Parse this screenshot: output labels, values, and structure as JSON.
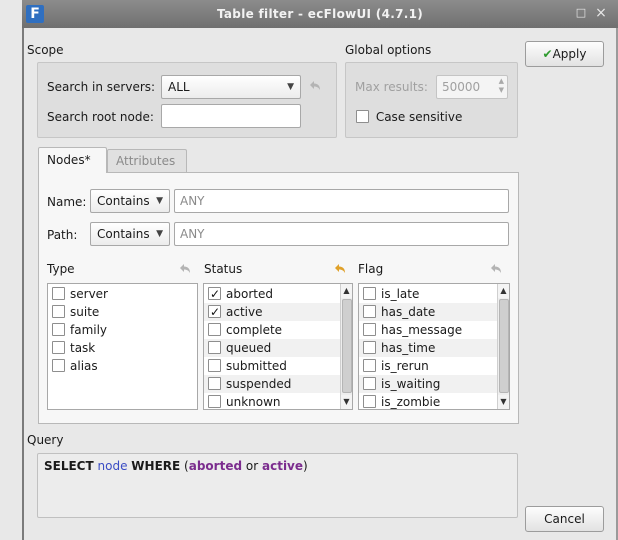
{
  "window": {
    "title": "Table filter  -  ecFlowUI (4.7.1)",
    "app_icon_letter": "F",
    "maximize_glyph": "□",
    "close_glyph": "×"
  },
  "scope": {
    "heading": "Scope",
    "search_servers_label": "Search in servers:",
    "search_servers_value": "ALL",
    "search_root_label": "Search root node:",
    "search_root_value": ""
  },
  "global_options": {
    "heading": "Global options",
    "max_results_label": "Max results:",
    "max_results_value": "50000",
    "case_sensitive_label": "Case sensitive",
    "case_sensitive_checked": false
  },
  "buttons": {
    "apply_label": "Apply",
    "apply_icon": "✔",
    "cancel_label": "Cancel"
  },
  "tabs": [
    {
      "label": "Nodes*",
      "active": true
    },
    {
      "label": "Attributes",
      "active": false
    }
  ],
  "nodes": {
    "name_label": "Name:",
    "name_match": "Contains",
    "name_value": "ANY",
    "path_label": "Path:",
    "path_match": "Contains",
    "path_value": "ANY"
  },
  "type_panel": {
    "heading": "Type",
    "items": [
      {
        "label": "server",
        "checked": false
      },
      {
        "label": "suite",
        "checked": false
      },
      {
        "label": "family",
        "checked": false
      },
      {
        "label": "task",
        "checked": false
      },
      {
        "label": "alias",
        "checked": false
      }
    ]
  },
  "status_panel": {
    "heading": "Status",
    "items": [
      {
        "label": "aborted",
        "checked": true
      },
      {
        "label": "active",
        "checked": true
      },
      {
        "label": "complete",
        "checked": false
      },
      {
        "label": "queued",
        "checked": false
      },
      {
        "label": "submitted",
        "checked": false
      },
      {
        "label": "suspended",
        "checked": false
      },
      {
        "label": "unknown",
        "checked": false
      }
    ]
  },
  "flag_panel": {
    "heading": "Flag",
    "items": [
      {
        "label": "is_late",
        "checked": false
      },
      {
        "label": "has_date",
        "checked": false
      },
      {
        "label": "has_message",
        "checked": false
      },
      {
        "label": "has_time",
        "checked": false
      },
      {
        "label": "is_rerun",
        "checked": false
      },
      {
        "label": "is_waiting",
        "checked": false
      },
      {
        "label": "is_zombie",
        "checked": false
      }
    ]
  },
  "query": {
    "heading": "Query",
    "select_kw": "SELECT",
    "node_kw": "node",
    "where_kw": "WHERE",
    "open_paren": "(",
    "value1": "aborted",
    "or_kw": "or",
    "value2": "active",
    "close_paren": ")"
  },
  "colors": {
    "apply_check": "#2e9a2e",
    "undo_active": "#e0a12a",
    "undo_inactive": "#b4b4b4",
    "query_identifier": "#3a4cc4",
    "query_value": "#7b2c8e"
  },
  "icons": {
    "undo": "undo-arrow-icon",
    "dropdown": "chevron-down-icon",
    "spin": "spin-arrows-icon"
  }
}
